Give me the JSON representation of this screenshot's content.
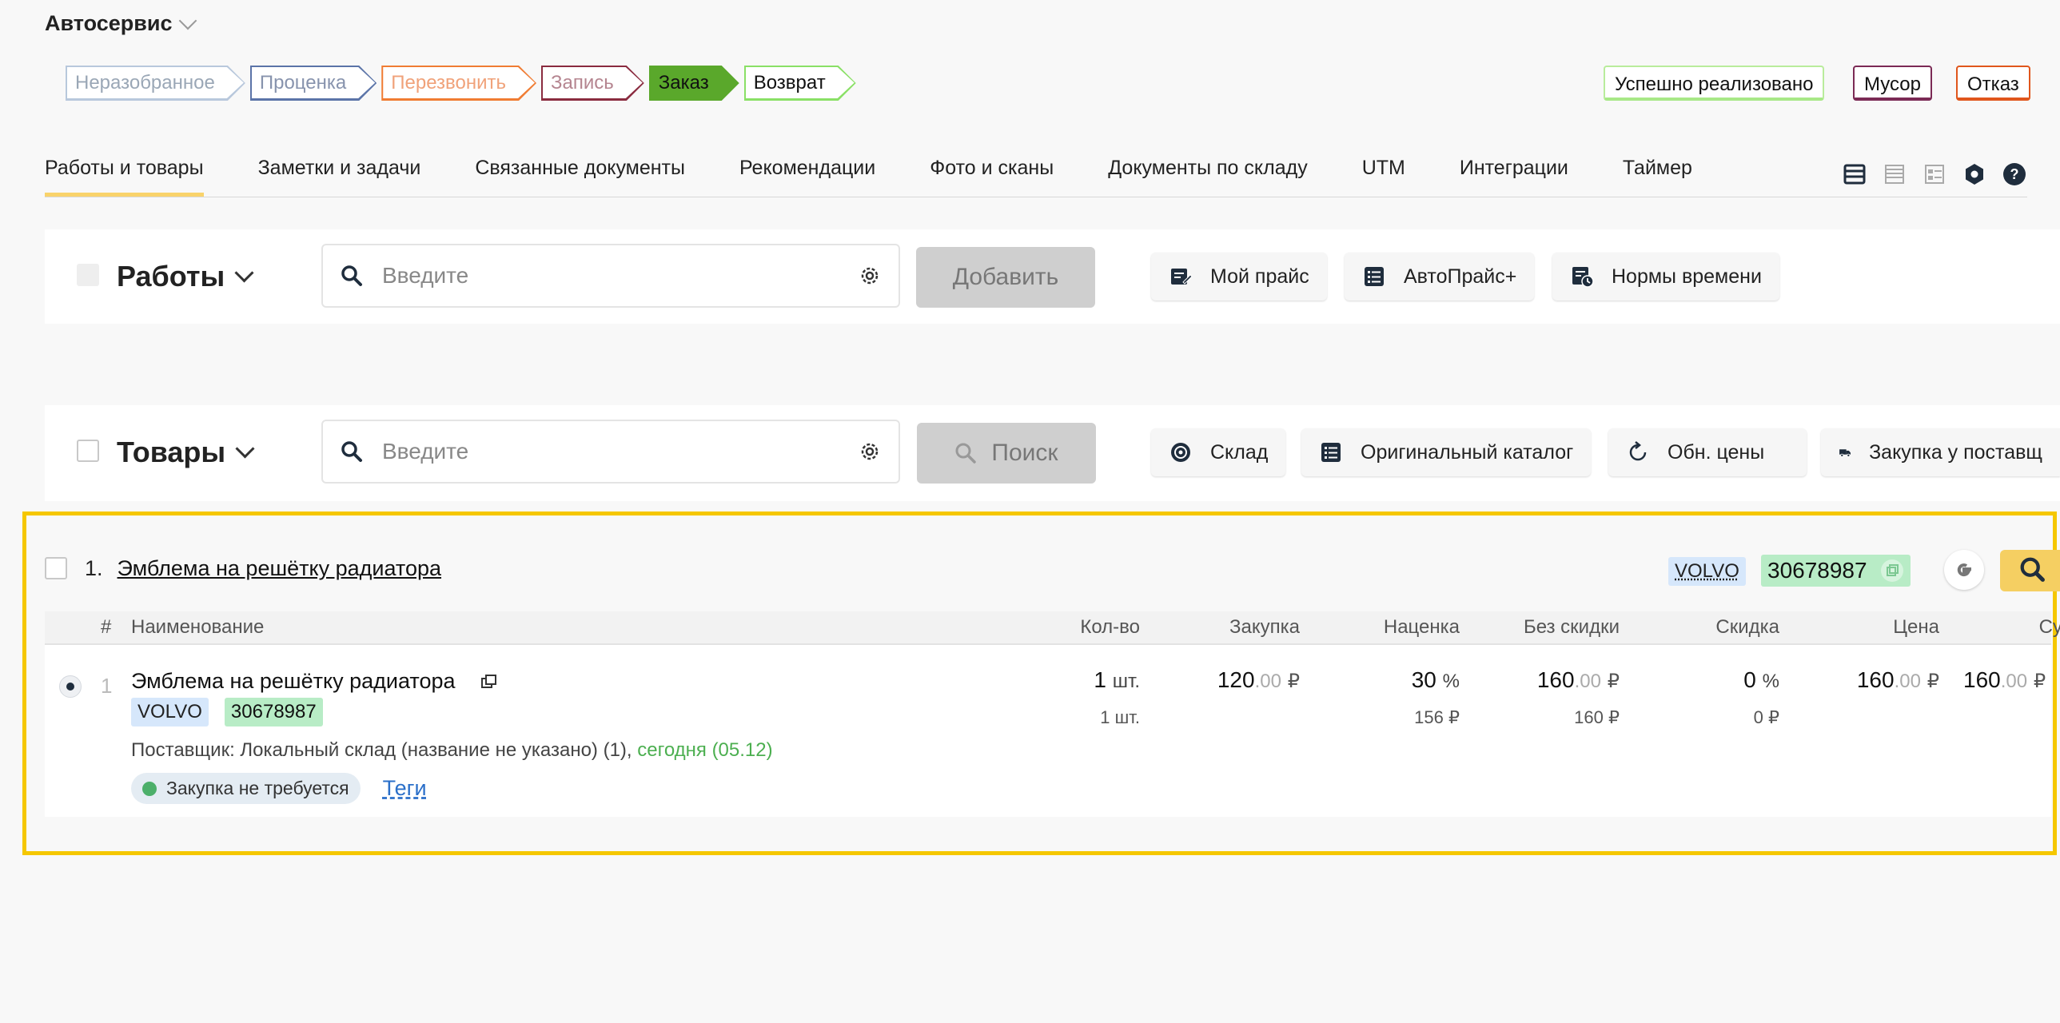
{
  "app": {
    "title": "Автосервис"
  },
  "stages": [
    "Неразобранное",
    "Проценка",
    "Перезвонить",
    "Запись",
    "Заказ",
    "Возврат"
  ],
  "results": [
    "Успешно реализовано",
    "Мусор",
    "Отказ"
  ],
  "tabs": [
    "Работы и товары",
    "Заметки и задачи",
    "Связанные документы",
    "Рекомендации",
    "Фото и сканы",
    "Документы по складу",
    "UTM",
    "Интеграции",
    "Таймер"
  ],
  "works": {
    "title": "Работы",
    "search_placeholder": "Введите",
    "add_label": "Добавить",
    "tools": [
      "Мой прайс",
      "АвтоПрайс+",
      "Нормы времени"
    ]
  },
  "goods": {
    "title": "Товары",
    "search_placeholder": "Введите",
    "search_label": "Поиск",
    "tools": [
      "Склад",
      "Оригинальный каталог",
      "Обн. цены",
      "Закупка у поставщ"
    ]
  },
  "product": {
    "index": "1.",
    "title": "Эмблема на решётку радиатора",
    "brand": "VOLVO",
    "article": "30678987"
  },
  "table": {
    "headers": [
      "#",
      "Наименование",
      "Кол-во",
      "Закупка",
      "Наценка",
      "Без скидки",
      "Скидка",
      "Цена",
      "Сумма"
    ],
    "row": {
      "num": "1",
      "name": "Эмблема на решётку радиатора",
      "brand": "VOLVO",
      "article": "30678987",
      "supplier": "Поставщик: Локальный склад (название не указано) (1),",
      "supplier_date": "сегодня (05.12)",
      "purchase_status": "Закупка не требуется",
      "tags_label": "Теги",
      "qty": "1",
      "qty_unit": "шт.",
      "qty_sub": "1 шт.",
      "purchase": "120",
      "purchase_dec": ".00",
      "markup": "30",
      "markup_unit": "%",
      "markup_sub": "156 ₽",
      "no_discount": "160",
      "no_discount_dec": ".00",
      "no_discount_sub": "160 ₽",
      "discount": "0",
      "discount_unit": "%",
      "discount_sub": "0 ₽",
      "price": "160",
      "price_dec": ".00",
      "sum": "160",
      "sum_dec": ".00",
      "currency": "₽"
    }
  },
  "colors": {
    "accent": "#f5c700",
    "tab_underline": "#f9d36b",
    "stage_active": "#5aa82b"
  }
}
